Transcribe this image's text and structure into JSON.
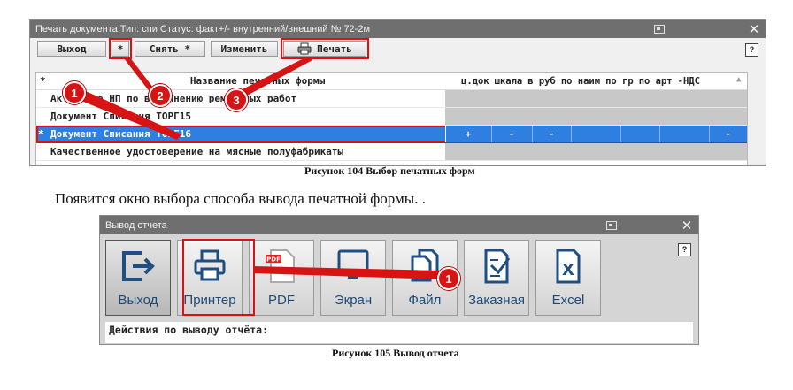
{
  "window1": {
    "title": "Печать документа  Тип: спи Статус: факт+/- внутренний/внешний   № 72-2м",
    "toolbar": {
      "exit_label": "Выход",
      "star_label": "*",
      "remove_label": "Снять  *",
      "edit_label": "Изменить",
      "print_label": "Печать"
    },
    "help_label": "?",
    "grid": {
      "header_star": "*",
      "header_name": "Название печатных формы",
      "columns": [
        "ц.док",
        "шкала",
        "в руб",
        "по наим",
        "по гр",
        "по арт",
        "-НДС"
      ],
      "rows": [
        {
          "name": "Акт учета НП по выполнению ремонтных работ",
          "selected": false
        },
        {
          "name": "Документ Списания ТОРГ15",
          "selected": false
        },
        {
          "name": "Документ Списания ТОРГ16",
          "selected": true,
          "marker": "*",
          "cells": [
            "+",
            "-",
            "-",
            "",
            "",
            "",
            "-"
          ]
        },
        {
          "name": "Качественное удостоверение на мясные полуфабрикаты",
          "selected": false
        }
      ]
    }
  },
  "caption1": "Рисунок 104 Выбор печатных форм",
  "body_text": "Появится окно выбора способа вывода печатной формы. .",
  "window2": {
    "title": "Вывод отчета",
    "help_label": "?",
    "buttons": [
      {
        "label": "Выход",
        "icon": "exit-icon"
      },
      {
        "label": "Принтер",
        "icon": "printer-icon"
      },
      {
        "label": "PDF",
        "icon": "pdf-icon"
      },
      {
        "label": "Экран",
        "icon": "screen-icon"
      },
      {
        "label": "Файл",
        "icon": "file-icon"
      },
      {
        "label": "Заказная",
        "icon": "custom-order-icon"
      },
      {
        "label": "Excel",
        "icon": "excel-icon"
      }
    ],
    "actions_label": "Действия по выводу отчёта:"
  },
  "caption2": "Рисунок 105 Вывод отчета",
  "callouts": {
    "one": "1",
    "two": "2",
    "three": "3",
    "win2_one": "1"
  },
  "colors": {
    "highlight": "#d61414",
    "selection": "#2f7fe0",
    "titlebar": "#6f6f6f",
    "button_text": "#1c4a78"
  }
}
